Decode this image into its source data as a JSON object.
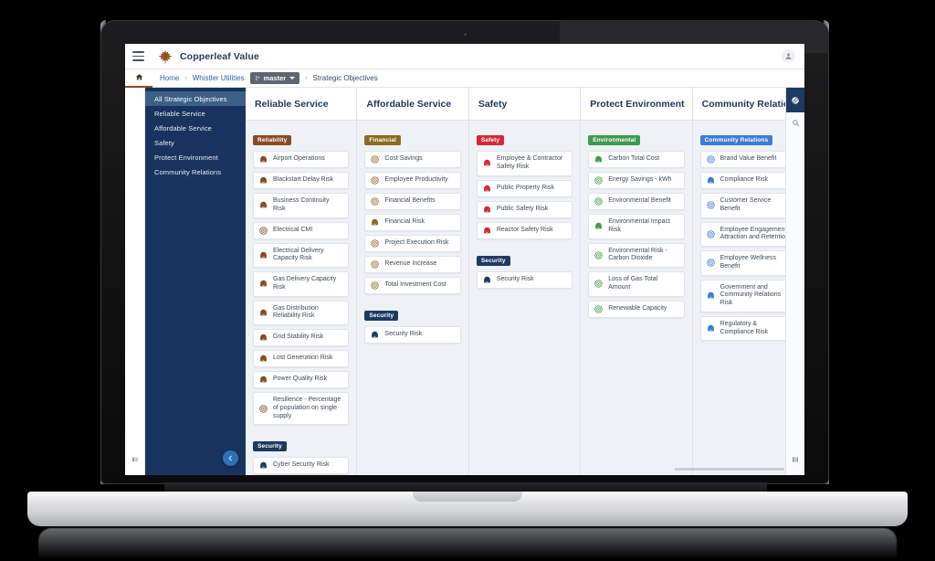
{
  "app": {
    "brand": "Copperleaf Value",
    "menu_icon": "hamburger-icon",
    "logo_icon": "maple-leaf-icon",
    "avatar_icon": "user-avatar-icon"
  },
  "breadcrumb": {
    "home_icon": "home-icon",
    "items": [
      {
        "label": "Home",
        "type": "link"
      },
      {
        "label": "Whistler Utilities",
        "type": "link"
      },
      {
        "label": "master",
        "type": "branch-chip"
      },
      {
        "label": "Strategic Objectives",
        "type": "current"
      }
    ],
    "separator": "›"
  },
  "sidebar": {
    "items": [
      {
        "label": "All Strategic Objectives",
        "active": true
      },
      {
        "label": "Reliable Service",
        "active": false
      },
      {
        "label": "Affordable Service",
        "active": false
      },
      {
        "label": "Safety",
        "active": false
      },
      {
        "label": "Protect Environment",
        "active": false
      },
      {
        "label": "Community Relations",
        "active": false
      }
    ],
    "collapse_icon": "chevron-left-icon"
  },
  "right_rail": {
    "items": [
      {
        "icon": "attachment-link-icon",
        "active": true
      },
      {
        "icon": "search-icon",
        "active": false
      }
    ],
    "bottom_icon": "grid-layout-icon"
  },
  "colors": {
    "reliability": "#8a4a22",
    "financial": "#8a6d1e",
    "safety": "#d42a34",
    "environmental": "#3f9b4f",
    "community": "#3b7dd8",
    "security": "#1d3a63",
    "accent": "#2f6fb5",
    "sidebar": "#18335e",
    "title": "#1d3a63"
  },
  "board": {
    "columns": [
      {
        "title": "Reliable Service",
        "groups": [
          {
            "tag": "Reliability",
            "color": "#8a4a22",
            "cards": [
              {
                "label": "Airport Operations",
                "icon": "risk-bell-icon"
              },
              {
                "label": "Blackstart Delay Risk",
                "icon": "risk-bell-icon"
              },
              {
                "label": "Business Continuity Risk",
                "icon": "risk-bell-icon"
              },
              {
                "label": "Electrical CMI",
                "icon": "target-icon"
              },
              {
                "label": "Electrical Delivery Capacity Risk",
                "icon": "risk-bell-icon"
              },
              {
                "label": "Gas Delivery Capacity Risk",
                "icon": "risk-bell-icon"
              },
              {
                "label": "Gas Distribution Reliability Risk",
                "icon": "risk-bell-icon"
              },
              {
                "label": "Grid Stability Risk",
                "icon": "risk-bell-icon"
              },
              {
                "label": "Lost Generation Risk",
                "icon": "risk-bell-icon"
              },
              {
                "label": "Power Quality Risk",
                "icon": "risk-bell-icon"
              },
              {
                "label": "Resilience - Percentage of population on single supply",
                "icon": "target-icon"
              }
            ]
          },
          {
            "tag": "Security",
            "color": "#1d3a63",
            "cards": [
              {
                "label": "Cyber Security Risk",
                "icon": "risk-bell-icon"
              }
            ]
          }
        ]
      },
      {
        "title": "Affordable Service",
        "groups": [
          {
            "tag": "Financial",
            "color": "#8a6d1e",
            "cards": [
              {
                "label": "Cost Savings",
                "icon": "target-icon"
              },
              {
                "label": "Employee Productivity",
                "icon": "target-icon"
              },
              {
                "label": "Financial Benefits",
                "icon": "target-icon"
              },
              {
                "label": "Financial Risk",
                "icon": "risk-bell-icon"
              },
              {
                "label": "Project Execution Risk",
                "icon": "target-icon"
              },
              {
                "label": "Revenue Increase",
                "icon": "target-icon"
              },
              {
                "label": "Total Investment Cost",
                "icon": "target-icon"
              }
            ]
          },
          {
            "tag": "Security",
            "color": "#1d3a63",
            "cards": [
              {
                "label": "Security Risk",
                "icon": "risk-bell-icon"
              }
            ]
          }
        ]
      },
      {
        "title": "Safety",
        "groups": [
          {
            "tag": "Safety",
            "color": "#d42a34",
            "cards": [
              {
                "label": "Employee & Contractor Safety Risk",
                "icon": "risk-bell-icon"
              },
              {
                "label": "Public Property Risk",
                "icon": "risk-bell-icon"
              },
              {
                "label": "Public Safety Risk",
                "icon": "risk-bell-icon"
              },
              {
                "label": "Reactor Safety Risk",
                "icon": "risk-bell-icon"
              }
            ]
          },
          {
            "tag": "Security",
            "color": "#1d3a63",
            "cards": [
              {
                "label": "Security Risk",
                "icon": "risk-bell-icon"
              }
            ]
          }
        ]
      },
      {
        "title": "Protect Environment",
        "groups": [
          {
            "tag": "Environmental",
            "color": "#3f9b4f",
            "cards": [
              {
                "label": "Carbon Total Cost",
                "icon": "risk-bell-icon"
              },
              {
                "label": "Energy Savings - kWh",
                "icon": "target-icon"
              },
              {
                "label": "Environmental Benefit",
                "icon": "target-icon"
              },
              {
                "label": "Environmental Impact Risk",
                "icon": "risk-bell-icon"
              },
              {
                "label": "Environmental Risk - Carbon Dioxide",
                "icon": "target-icon"
              },
              {
                "label": "Loss of Gas Total Amount",
                "icon": "target-icon"
              },
              {
                "label": "Renewable Capacity",
                "icon": "target-icon"
              }
            ]
          }
        ]
      },
      {
        "title": "Community Relations",
        "groups": [
          {
            "tag": "Community Relations",
            "color": "#3b7dd8",
            "cards": [
              {
                "label": "Brand Value Benefit",
                "icon": "target-icon"
              },
              {
                "label": "Compliance Risk",
                "icon": "risk-bell-icon"
              },
              {
                "label": "Customer Service Benefit",
                "icon": "target-icon"
              },
              {
                "label": "Employee Engagement, Attraction and Retention",
                "icon": "target-icon"
              },
              {
                "label": "Employee Wellness Benefit",
                "icon": "target-icon"
              },
              {
                "label": "Government and Community Relations Risk",
                "icon": "risk-bell-icon"
              },
              {
                "label": "Regulatory & Compliance Risk",
                "icon": "risk-bell-icon"
              }
            ]
          }
        ]
      }
    ]
  }
}
